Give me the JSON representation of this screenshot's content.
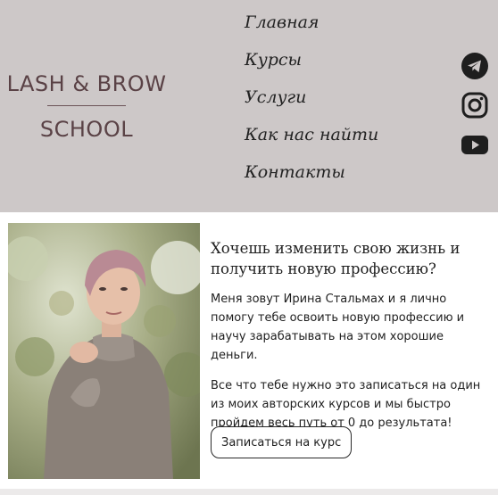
{
  "logo": {
    "top": "LASH & BROW",
    "bottom": "SCHOOL"
  },
  "nav": [
    {
      "label": "Главная"
    },
    {
      "label": "Курсы"
    },
    {
      "label": "Услуги"
    },
    {
      "label": "Как нас найти"
    },
    {
      "label": "Контакты"
    }
  ],
  "social": [
    "telegram-icon",
    "instagram-icon",
    "youtube-icon"
  ],
  "hero": {
    "headline": "Хочешь изменить свою жизнь и получить новую профессию?",
    "para1": "Меня зовут Ирина Стальмах и я лично помогу тебе освоить новую профессию и научу зарабатывать на этом хорошие деньги.",
    "para2": "Все что тебе нужно это записаться на один из моих авторских курсов и мы быстро пройдем весь путь от 0 до результата!",
    "cta": "Записаться на курс"
  },
  "colors": {
    "header_bg": "#cdc8c8",
    "logo": "#5a4246",
    "icon": "#1e1e1e"
  }
}
